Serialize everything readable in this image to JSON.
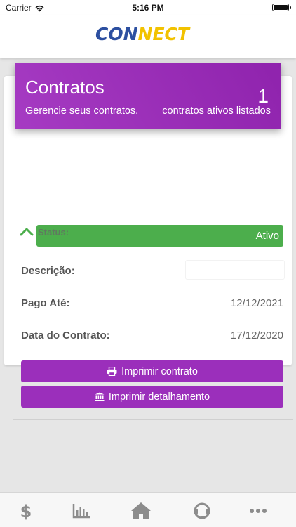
{
  "statusbar": {
    "carrier": "Carrier",
    "time": "5:16 PM"
  },
  "header": {
    "logo_part1": "CON",
    "logo_part2": "NECT"
  },
  "banner": {
    "title": "Contratos",
    "subtitle": "Gerencie seus contratos.",
    "count": "1",
    "count_label": "contratos ativos listados"
  },
  "contract": {
    "status_label": "Status:",
    "status_value": "Ativo",
    "description_label": "Descrição:",
    "description_value": "",
    "paid_until_label": "Pago Até:",
    "paid_until_value": "12/12/2021",
    "contract_date_label": "Data do Contrato:",
    "contract_date_value": "17/12/2020",
    "print_contract_label": "Imprimir contrato",
    "print_details_label": "Imprimir detalhamento"
  },
  "tabbar": {
    "items": [
      {
        "icon": "dollar-icon"
      },
      {
        "icon": "bar-chart-icon"
      },
      {
        "icon": "home-icon"
      },
      {
        "icon": "headset-icon"
      },
      {
        "icon": "more-icon"
      }
    ]
  },
  "colors": {
    "banner": "#9b2fbb",
    "status_active": "#4cae4c",
    "button": "#9b2fbb",
    "logo_blue": "#2c4fa0",
    "logo_yellow": "#f2c200"
  }
}
